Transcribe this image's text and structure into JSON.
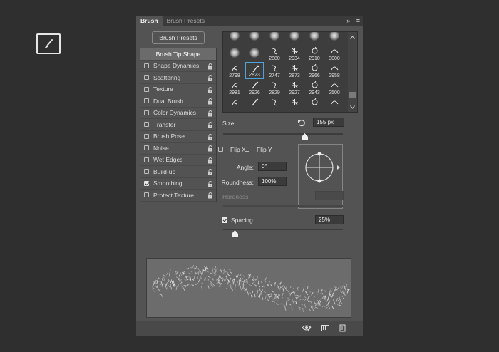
{
  "panel": {
    "tabs": [
      "Brush",
      "Brush Presets"
    ],
    "collapse_label": "»",
    "menu_label": "≡"
  },
  "presets_button_label": "Brush Presets",
  "options": {
    "header": "Brush Tip Shape",
    "items": [
      {
        "label": "Shape Dynamics",
        "checked": false
      },
      {
        "label": "Scattering",
        "checked": false
      },
      {
        "label": "Texture",
        "checked": false
      },
      {
        "label": "Dual Brush",
        "checked": false
      },
      {
        "label": "Color Dynamics",
        "checked": false
      },
      {
        "label": "Transfer",
        "checked": false
      },
      {
        "label": "Brush Pose",
        "checked": false
      },
      {
        "label": "Noise",
        "checked": false
      },
      {
        "label": "Wet Edges",
        "checked": false
      },
      {
        "label": "Build-up",
        "checked": false
      },
      {
        "label": "Smoothing",
        "checked": true
      },
      {
        "label": "Protect Texture",
        "checked": false
      }
    ]
  },
  "brush_grid": {
    "rows": [
      [
        "",
        "",
        "",
        "",
        "",
        ""
      ],
      [
        "",
        "",
        "2880",
        "2934",
        "2910",
        "3000"
      ],
      [
        "2798",
        "2823",
        "2747",
        "2873",
        "2966",
        "2958"
      ],
      [
        "2981",
        "2926",
        "2829",
        "2927",
        "2943",
        "2500"
      ],
      [
        "",
        "",
        "",
        "",
        "",
        ""
      ]
    ],
    "selected": "2823"
  },
  "size": {
    "label": "Size",
    "value": "155 px",
    "level": 0.68
  },
  "flip_x": {
    "label": "Flip X",
    "checked": false
  },
  "flip_y": {
    "label": "Flip Y",
    "checked": false
  },
  "angle": {
    "label": "Angle:",
    "value": "0°"
  },
  "roundness": {
    "label": "Roundness:",
    "value": "100%"
  },
  "hardness": {
    "label": "Hardness",
    "value": ""
  },
  "spacing": {
    "label": "Spacing",
    "checked": true,
    "value": "25%",
    "level": 0.1
  },
  "colors": {
    "selection": "#4fa3d8",
    "panel": "#535353",
    "background": "#2f2f2f"
  }
}
